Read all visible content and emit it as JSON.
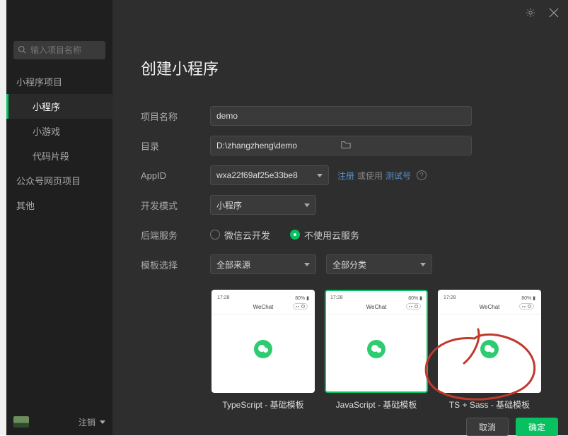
{
  "sidebar": {
    "search_placeholder": "输入项目名称",
    "section1_header": "小程序项目",
    "section1_items": [
      "小程序",
      "小游戏",
      "代码片段"
    ],
    "section2_header": "公众号网页项目",
    "section3_header": "其他",
    "logout_label": "注销"
  },
  "page": {
    "title": "创建小程序"
  },
  "form": {
    "name_label": "项目名称",
    "name_value": "demo",
    "dir_label": "目录",
    "dir_value": "D:\\zhangzheng\\demo",
    "appid_label": "AppID",
    "appid_value": "wxa22f69af25e33be8",
    "register_link": "注册",
    "or_use_text": "或使用",
    "test_link": "测试号",
    "mode_label": "开发模式",
    "mode_value": "小程序",
    "backend_label": "后端服务",
    "backend_opt1": "微信云开发",
    "backend_opt2": "不使用云服务",
    "tpl_label": "模板选择",
    "tpl_source": "全部来源",
    "tpl_cat": "全部分类"
  },
  "templates": [
    {
      "title": "TypeScript - 基础模板",
      "selected": false,
      "nav": "WeChat"
    },
    {
      "title": "JavaScript - 基础模板",
      "selected": true,
      "nav": "WeChat"
    },
    {
      "title": "TS + Sass - 基础模板",
      "selected": false,
      "nav": "WeChat"
    }
  ],
  "buttons": {
    "cancel": "取消",
    "confirm": "确定"
  }
}
